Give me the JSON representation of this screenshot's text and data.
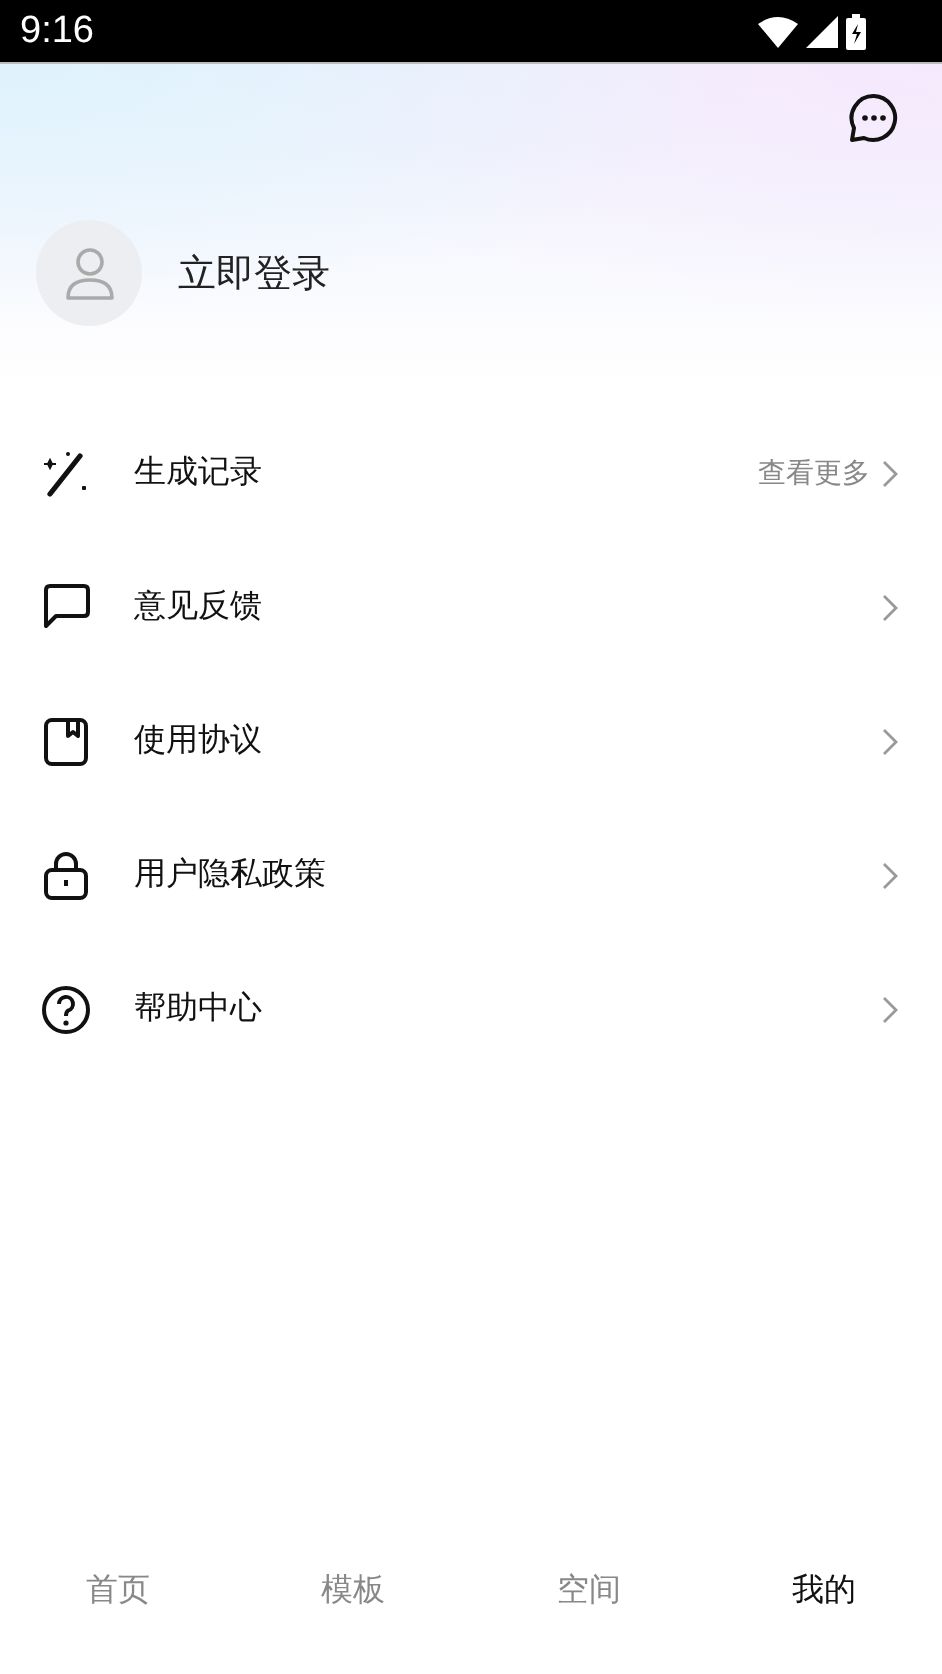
{
  "status_bar": {
    "time": "9:16"
  },
  "profile": {
    "login_label": "立即登录"
  },
  "menu": [
    {
      "kind": "history",
      "label": "生成记录",
      "extra": "查看更多"
    },
    {
      "kind": "feedback",
      "label": "意见反馈"
    },
    {
      "kind": "agreement",
      "label": "使用协议"
    },
    {
      "kind": "privacy",
      "label": "用户隐私政策"
    },
    {
      "kind": "help",
      "label": "帮助中心"
    }
  ],
  "tabs": [
    {
      "label": "首页",
      "selected": false
    },
    {
      "label": "模板",
      "selected": false
    },
    {
      "label": "空间",
      "selected": false
    },
    {
      "label": "我的",
      "selected": true
    }
  ]
}
